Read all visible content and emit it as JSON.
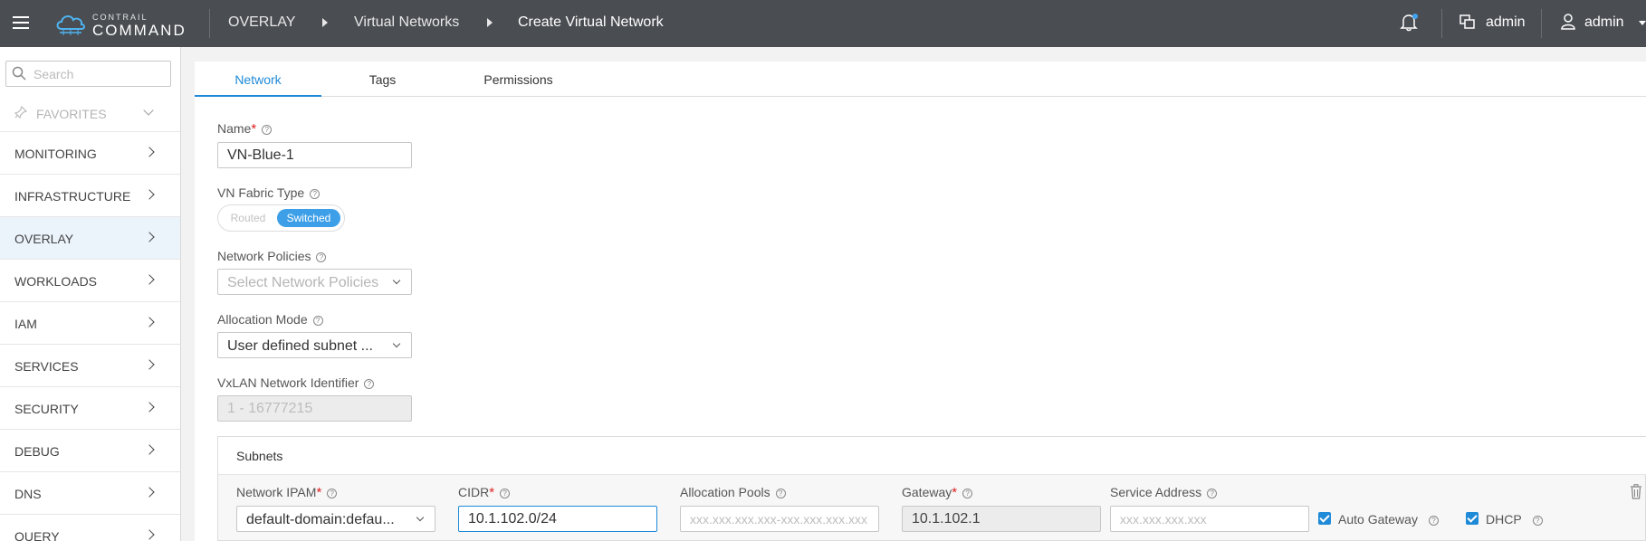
{
  "logo": {
    "small": "CONTRAIL",
    "big": "COMMAND"
  },
  "breadcrumb": [
    "OVERLAY",
    "Virtual Networks",
    "Create Virtual Network"
  ],
  "header": {
    "tenant": "admin",
    "user": "admin"
  },
  "search": {
    "placeholder": "Search"
  },
  "sidebar": {
    "favorites": "FAVORITES",
    "items": [
      {
        "label": "MONITORING"
      },
      {
        "label": "INFRASTRUCTURE"
      },
      {
        "label": "OVERLAY"
      },
      {
        "label": "WORKLOADS"
      },
      {
        "label": "IAM"
      },
      {
        "label": "SERVICES"
      },
      {
        "label": "SECURITY"
      },
      {
        "label": "DEBUG"
      },
      {
        "label": "DNS"
      },
      {
        "label": "QUERY"
      }
    ]
  },
  "tabs": [
    "Network",
    "Tags",
    "Permissions"
  ],
  "form": {
    "name_label": "Name",
    "name_value": "VN-Blue-1",
    "fabric_label": "VN Fabric Type",
    "fabric_routed": "Routed",
    "fabric_switched": "Switched",
    "policies_label": "Network Policies",
    "policies_placeholder": "Select Network Policies",
    "alloc_label": "Allocation Mode",
    "alloc_value": "User defined subnet ...",
    "vxlan_label": "VxLAN Network Identifier",
    "vxlan_placeholder": "1 - 16777215"
  },
  "subnets": {
    "title": "Subnets",
    "ipam_label": "Network IPAM",
    "ipam_value": "default-domain:defau...",
    "cidr_label": "CIDR",
    "cidr_value": "10.1.102.0/24",
    "pools_label": "Allocation Pools",
    "pools_placeholder": "xxx.xxx.xxx.xxx-xxx.xxx.xxx.xxx",
    "gateway_label": "Gateway",
    "gateway_value": "10.1.102.1",
    "service_label": "Service Address",
    "service_placeholder": "xxx.xxx.xxx.xxx",
    "auto_gateway_label": "Auto Gateway",
    "dhcp_label": "DHCP"
  },
  "colors": {
    "topbar": "#4a4d52",
    "accent": "#1f8ad7",
    "required": "#e02020"
  }
}
